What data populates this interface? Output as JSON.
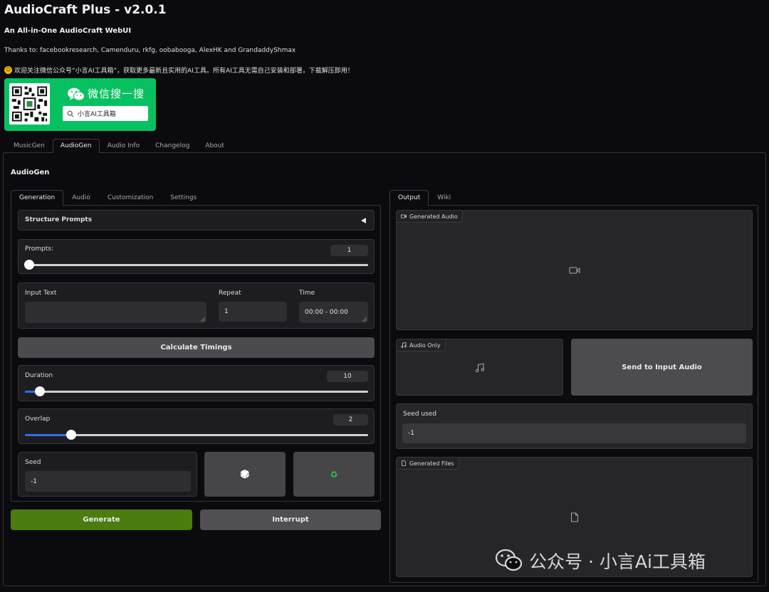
{
  "header": {
    "title": "AudioCraft Plus - v2.0.1",
    "subtitle": "An All-in-One AudioCraft WebUI",
    "thanks": "Thanks to: facebookresearch, Camenduru, rkfg, oobabooga, AlexHK and GrandaddyShmax",
    "notice": "欢迎关注微信公众号“小言AI工具箱”，获取更多最新且实用的AI工具。所有AI工具无需自己安装和部署，下载解压即用！"
  },
  "banner": {
    "heading": "微信搜一搜",
    "search_text": "小言AI工具箱",
    "color": "#07c160"
  },
  "top_tabs": [
    "MusicGen",
    "AudioGen",
    "Audio Info",
    "Changelog",
    "About"
  ],
  "section_title": "AudioGen",
  "left_tabs": [
    "Generation",
    "Audio",
    "Customization",
    "Settings"
  ],
  "structure_prompts": "Structure Prompts",
  "prompts": {
    "label": "Prompts:",
    "value": "1",
    "fraction": 0.0
  },
  "input_text": {
    "label": "Input Text",
    "value": ""
  },
  "repeat": {
    "label": "Repeat",
    "value": "1"
  },
  "time": {
    "label": "Time",
    "value": "00:00 - 00:00"
  },
  "calculate_timings": "Calculate Timings",
  "duration": {
    "label": "Duration",
    "value": "10",
    "fraction": 0.045
  },
  "overlap": {
    "label": "Overlap",
    "value": "2",
    "fraction": 0.135
  },
  "seed": {
    "label": "Seed",
    "value": "-1"
  },
  "dice_icon": "🎲",
  "recycle_icon": "♻",
  "generate_label": "Generate",
  "interrupt_label": "Interrupt",
  "right_tabs": [
    "Output",
    "Wiki"
  ],
  "generated_audio_label": "Generated Audio",
  "audio_only_label": "Audio Only",
  "send_to_input_audio": "Send to Input Audio",
  "seed_used": {
    "label": "Seed used",
    "value": "-1"
  },
  "generated_files_label": "Generated Files",
  "watermark": "公众号 · 小言Ai工具箱",
  "colors": {
    "accent_blue": "#2f6fe6",
    "generate_green": "#4a7c0f",
    "background": "#0b0b0f"
  }
}
